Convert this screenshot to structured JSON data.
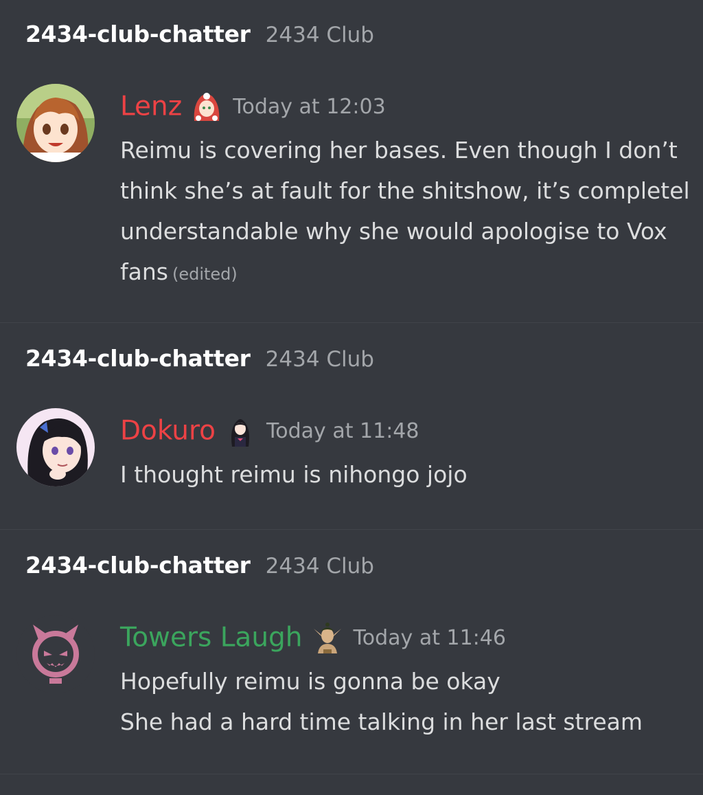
{
  "colors": {
    "background": "#36393f",
    "divider": "#41444a",
    "channel_text": "#ffffff",
    "muted_text": "#a3a6aa",
    "message_text": "#dcddde",
    "author_red": "#ed4245",
    "author_green": "#3ba55d"
  },
  "messages": [
    {
      "channel": "2434-club-chatter",
      "server": "2434 Club",
      "author": "Lenz",
      "author_color": "#ed4245",
      "role_icon": "red-hood-character-icon",
      "avatar_icon": "orange-hair-anime-girl-avatar",
      "timestamp": "Today at 12:03",
      "lines": [
        "Reimu is covering her bases. Even though I don’t",
        "think she’s at fault for the shitshow, it’s completel",
        "understandable why she would apologise to Vox",
        "fans"
      ],
      "edited": "(edited)"
    },
    {
      "channel": "2434-club-chatter",
      "server": "2434 Club",
      "author": "Dokuro",
      "author_color": "#ed4245",
      "role_icon": "dark-hair-character-icon",
      "avatar_icon": "black-hair-anime-girl-avatar",
      "timestamp": "Today at 11:48",
      "lines": [
        "I thought reimu is nihongo jojo"
      ]
    },
    {
      "channel": "2434-club-chatter",
      "server": "2434 Club",
      "author": "Towers Laugh",
      "author_color": "#3ba55d",
      "role_icon": "elf-character-icon",
      "avatar_icon": "pink-demon-face-avatar",
      "timestamp": "Today at 11:46",
      "lines": [
        "Hopefully reimu is gonna be okay",
        "She had a hard time talking in her last stream"
      ]
    }
  ]
}
